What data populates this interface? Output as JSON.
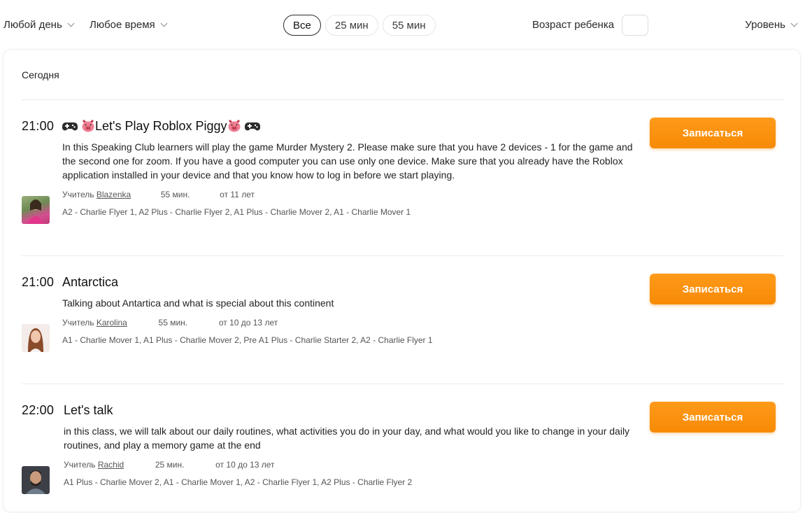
{
  "filters": {
    "day_label": "Любой день",
    "time_label": "Любое время",
    "durations": [
      "Все",
      "25 мин",
      "55 мин"
    ],
    "age_label": "Возраст ребенка",
    "age_value": "",
    "level_label": "Уровень"
  },
  "schedule": {
    "day_title": "Сегодня",
    "lessons": [
      {
        "time": "21:00",
        "title": "Let's Play Roblox Piggy",
        "description": "In this Speaking Club learners will play the game Murder Mystery 2. Please make sure that you have 2 devices - 1 for the game and the second one for zoom. If you have a good computer you can use only one device. Make sure that you already have the Roblox application installed in your device and that you know how to log in before we start playing.",
        "teacher_prefix": "Учитель",
        "teacher": "Blazenka",
        "duration": "55 мин.",
        "age": "от 11 лет",
        "levels": "A2 - Charlie Flyer 1, A2 Plus - Charlie Flyer 2, A1 Plus - Charlie Mover 2, A1 - Charlie Mover 1",
        "button": "Записаться"
      },
      {
        "time": "21:00",
        "title": "Antarctica",
        "description": "Talking about Antartica and what is special about this continent",
        "teacher_prefix": "Учитель",
        "teacher": "Karolina",
        "duration": "55 мин.",
        "age": "от 10 до 13 лет",
        "levels": "A1 - Charlie Mover 1, A1 Plus - Charlie Mover 2, Pre A1 Plus - Charlie Starter 2, A2 - Charlie Flyer 1",
        "button": "Записаться"
      },
      {
        "time": "22:00",
        "title": "Let's talk",
        "description": "in this class, we will talk about our daily routines, what activities you do in your day, and what would you like to change in your daily routines, and play a memory game at the end",
        "teacher_prefix": "Учитель",
        "teacher": "Rachid",
        "duration": "25 мин.",
        "age": "от 10 до 13 лет",
        "levels": "A1 Plus - Charlie Mover 2, A1 - Charlie Mover 1, A2 - Charlie Flyer 1, A2 Plus - Charlie Flyer 2",
        "button": "Записаться"
      }
    ]
  },
  "colors": {
    "accent": "#f78a05",
    "text": "#1f1f1f",
    "muted": "#555555"
  },
  "icons": [
    "gamepad-icon",
    "pig-icon",
    "chevron-down-icon"
  ]
}
